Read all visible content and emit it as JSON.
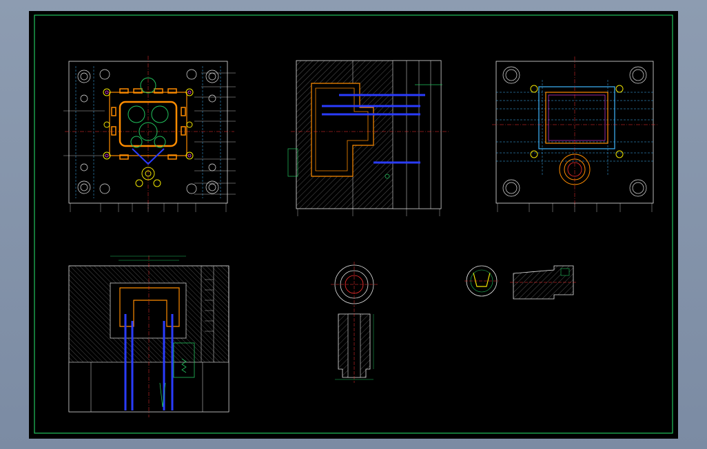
{
  "window": {
    "background_color": "#8595ad",
    "sheet_color": "#000000",
    "frame_color": "#22c55e"
  },
  "drawing": {
    "view_captions": [
      "",
      "",
      "",
      "",
      "",
      ""
    ],
    "note_text": ""
  },
  "colors": {
    "outline": "#e6e6e6",
    "centerline": "#ff3030",
    "cavity": "#ff8c00",
    "yellow": "#f2e600",
    "green": "#22c55e",
    "cyan": "#3fb7ff",
    "blue": "#2a3cff",
    "magenta": "#ff40ff"
  }
}
